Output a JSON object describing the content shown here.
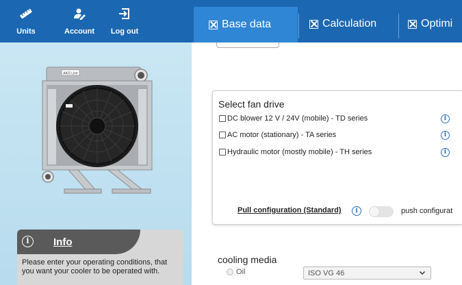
{
  "toolbar": {
    "units_label": "Units",
    "account_label": "Account",
    "logout_label": "Log out"
  },
  "tabs": [
    {
      "label": "Base data",
      "active": true
    },
    {
      "label": "Calculation",
      "active": false
    },
    {
      "label": "Optimi",
      "active": false
    }
  ],
  "left_panel": {
    "product_label": "AKG Line",
    "info": {
      "title": "Info",
      "text": "Please enter your operating conditions, that you want your cooler to be operated with."
    }
  },
  "fan_drive": {
    "title": "Select fan drive",
    "options": [
      {
        "label": "DC blower 12 V / 24V (mobile) - TD series",
        "checked": false
      },
      {
        "label": "AC motor (stationary) - TA series",
        "checked": false
      },
      {
        "label": "Hydraulic motor (mostly mobile) - TH series",
        "checked": false
      }
    ],
    "pull_label": "Pull configuration (Standard)",
    "push_label": "push configurat",
    "push_enabled": false
  },
  "cooling_media": {
    "title": "cooling media",
    "radio_label": "Oil",
    "select_value": "ISO VG 46"
  },
  "colors": {
    "header_blue": "#1b67b2",
    "active_tab_blue": "#2f86d4",
    "panel_blue": "#c9e6f3",
    "info_blue": "#2a6fc0"
  },
  "icons": {
    "units": "ruler-icon",
    "account": "user-edit-icon",
    "logout": "logout-icon",
    "tab_box": "checkbox-x-icon",
    "help": "info-circle-icon",
    "select_caret": "chevron-down-icon"
  }
}
